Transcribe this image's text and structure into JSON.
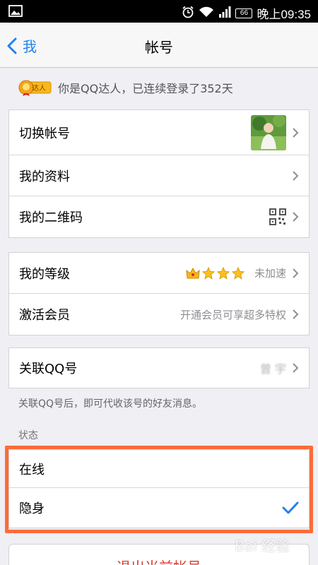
{
  "status_bar": {
    "battery": "66",
    "time": "晚上09:35",
    "icons": [
      "image-icon",
      "alarm-icon",
      "wifi-icon",
      "signal-icon"
    ]
  },
  "nav": {
    "back_label": "我",
    "title": "帐号"
  },
  "daren": {
    "badge_text": "达人",
    "text": "你是QQ达人，已连续登录了352天"
  },
  "account_group": {
    "switch_account": "切换帐号",
    "my_profile": "我的资料",
    "my_qrcode": "我的二维码"
  },
  "level_group": {
    "my_level": "我的等级",
    "level_status": "未加速",
    "activate_member": "激活会员",
    "activate_hint": "开通会员可享超多特权"
  },
  "link_group": {
    "linked_qq": "关联QQ号",
    "linked_value": "曾 宇"
  },
  "link_note": "关联QQ号后，即可代收该号的好友消息。",
  "status_section": {
    "header": "状态",
    "online": "在线",
    "invisible": "隐身",
    "selected": "invisible"
  },
  "logout_label": "退出当前帐号",
  "watermark": "Bai 经验",
  "colors": {
    "accent": "#1f82f0",
    "highlight_border": "#ff6c3a",
    "logout_text": "#e0382f"
  }
}
